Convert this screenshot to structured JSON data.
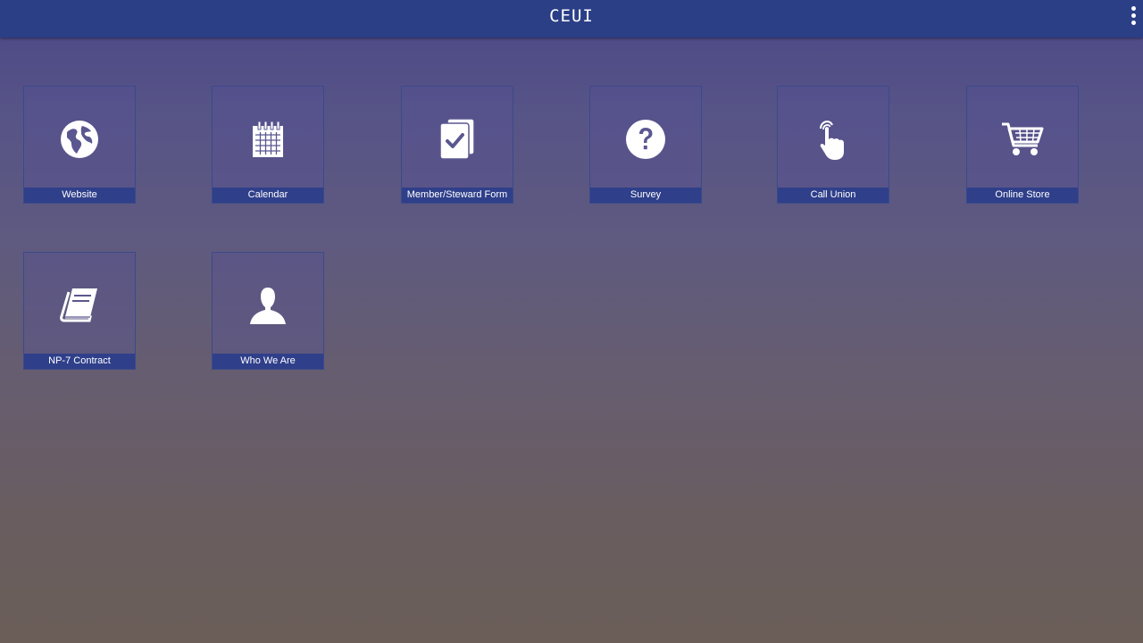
{
  "app": {
    "title": "CEUI"
  },
  "tiles": [
    {
      "label": "Website",
      "icon": "globe-icon"
    },
    {
      "label": "Calendar",
      "icon": "calendar-icon"
    },
    {
      "label": "Member/Steward Form",
      "icon": "form-check-icon"
    },
    {
      "label": "Survey",
      "icon": "question-icon"
    },
    {
      "label": "Call Union",
      "icon": "touch-hand-icon"
    },
    {
      "label": "Online Store",
      "icon": "shopping-cart-icon"
    },
    {
      "label": "NP-7 Contract",
      "icon": "book-icon"
    },
    {
      "label": "Who We Are",
      "icon": "person-icon"
    }
  ],
  "colors": {
    "topbar": "#2b3f87",
    "label_bar": "#2f3f8a",
    "icon": "#ffffff"
  }
}
